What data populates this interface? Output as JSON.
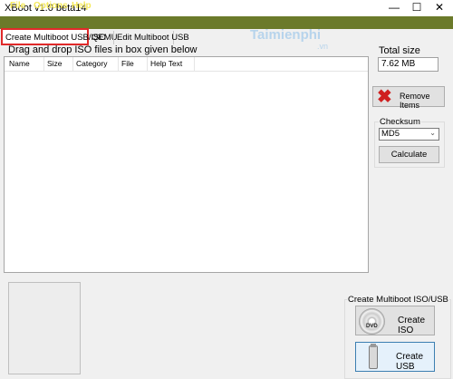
{
  "window": {
    "title": "XBoot v1.0 beta14",
    "min_glyph": "—",
    "max_glyph": "☐",
    "close_glyph": "✕"
  },
  "menu": {
    "items": [
      {
        "label": "File"
      },
      {
        "label": "Options"
      },
      {
        "label": "Help"
      }
    ],
    "bar_color": "#6b7a2a",
    "text_color": "#f5e95a"
  },
  "tabs": [
    {
      "label": "Create Multiboot USB/ISO",
      "selected": true
    },
    {
      "label": "QEMU"
    },
    {
      "label": "Edit Multiboot USB"
    }
  ],
  "watermark": {
    "text": "Taimienphi",
    "suffix": ".vn"
  },
  "main": {
    "instruction": "Drag and drop ISO files in box given below",
    "columns": [
      "Name",
      "Size",
      "Category",
      "File",
      "Help Text"
    ],
    "rows": []
  },
  "sidebar": {
    "total_size_label": "Total size",
    "total_size_value": "7.62 MB",
    "remove_button": "Remove Items",
    "checksum_label": "Checksum",
    "checksum_selected": "MD5",
    "calculate_button": "Calculate"
  },
  "create_group": {
    "label": "Create Multiboot ISO/USB",
    "create_iso_button": "Create ISO",
    "iso_icon_text": "DVD",
    "create_usb_button": "Create USB"
  }
}
